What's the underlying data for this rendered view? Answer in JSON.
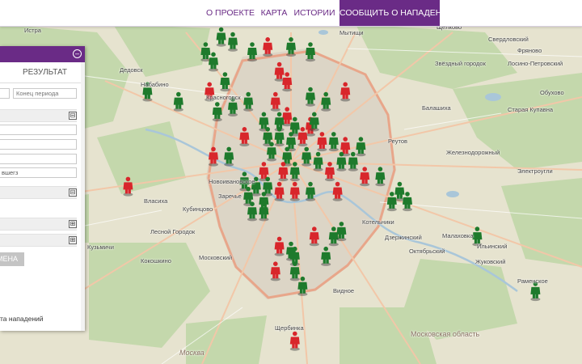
{
  "nav": {
    "items": [
      {
        "label": "О ПРОЕКТЕ"
      },
      {
        "label": "КАРТА"
      },
      {
        "label": "ИСТОРИИ"
      },
      {
        "label": "СООБЩИТЬ О НАПАДЕНИИ"
      }
    ],
    "active_index": 3,
    "accent_color": "#6a2b86"
  },
  "panel": {
    "close_icon": "close-circle-icon",
    "tab_result": "РЕЗУЛЬТАТ",
    "period_end_placeholder": "Конец периода",
    "victim_field_value": "вшегз",
    "apply_button": "МЕНА",
    "footer_text": "та нападений",
    "section_toggles": [
      "⊟",
      "⊟",
      "⊞",
      "⊞"
    ]
  },
  "map": {
    "labels": [
      {
        "text": "Истра"
      },
      {
        "text": "Мытищи"
      },
      {
        "text": "Щёлково"
      },
      {
        "text": "Свердловский"
      },
      {
        "text": "Звёздный городок"
      },
      {
        "text": "Лосино-Петровский"
      },
      {
        "text": "Фряново"
      },
      {
        "text": "Дедовск"
      },
      {
        "text": "Набабино"
      },
      {
        "text": "Балашиха"
      },
      {
        "text": "Старая Купавна"
      },
      {
        "text": "Красногорск"
      },
      {
        "text": "Реутов"
      },
      {
        "text": "Железнодорожный"
      },
      {
        "text": "Электроугли"
      },
      {
        "text": "Новоивановское"
      },
      {
        "text": "Заречье"
      },
      {
        "text": "Власиха"
      },
      {
        "text": "Лесной Городок"
      },
      {
        "text": "Кубинцово"
      },
      {
        "text": "Котельники"
      },
      {
        "text": "Дзержинский"
      },
      {
        "text": "Малаховка"
      },
      {
        "text": "Октябрьский"
      },
      {
        "text": "Жуковский"
      },
      {
        "text": "Раменское"
      },
      {
        "text": "Кокошкино"
      },
      {
        "text": "Московский"
      },
      {
        "text": "Видное"
      },
      {
        "text": "Щербинка"
      },
      {
        "text": "Москва"
      },
      {
        "text": "Московская область"
      },
      {
        "text": "Обухово"
      },
      {
        "text": "Ильинский"
      },
      {
        "text": "Кузьмичи"
      }
    ],
    "marker_colors": {
      "green": "#1e7a2c",
      "red": "#d8262b"
    },
    "markers": [
      {
        "color": "green",
        "lat": 55.95,
        "lon": 37.47
      },
      {
        "color": "green",
        "lat": 55.94,
        "lon": 37.5
      },
      {
        "color": "green",
        "lat": 55.92,
        "lon": 37.43
      },
      {
        "color": "green",
        "lat": 55.92,
        "lon": 37.55
      },
      {
        "color": "red",
        "lat": 55.93,
        "lon": 37.59
      },
      {
        "color": "green",
        "lat": 55.93,
        "lon": 37.65
      },
      {
        "color": "green",
        "lat": 55.92,
        "lon": 37.7
      },
      {
        "color": "green",
        "lat": 55.9,
        "lon": 37.45
      },
      {
        "color": "red",
        "lat": 55.88,
        "lon": 37.62
      },
      {
        "color": "red",
        "lat": 55.86,
        "lon": 37.64
      },
      {
        "color": "green",
        "lat": 55.86,
        "lon": 37.48
      },
      {
        "color": "green",
        "lat": 55.84,
        "lon": 37.28
      },
      {
        "color": "red",
        "lat": 55.84,
        "lon": 37.44
      },
      {
        "color": "green",
        "lat": 55.82,
        "lon": 37.36
      },
      {
        "color": "green",
        "lat": 55.81,
        "lon": 37.5
      },
      {
        "color": "green",
        "lat": 55.82,
        "lon": 37.54
      },
      {
        "color": "red",
        "lat": 55.82,
        "lon": 37.61
      },
      {
        "color": "green",
        "lat": 55.83,
        "lon": 37.7
      },
      {
        "color": "green",
        "lat": 55.82,
        "lon": 37.74
      },
      {
        "color": "red",
        "lat": 55.84,
        "lon": 37.79
      },
      {
        "color": "green",
        "lat": 55.8,
        "lon": 37.46
      },
      {
        "color": "red",
        "lat": 55.79,
        "lon": 37.64
      },
      {
        "color": "green",
        "lat": 55.78,
        "lon": 37.58
      },
      {
        "color": "green",
        "lat": 55.78,
        "lon": 37.62
      },
      {
        "color": "green",
        "lat": 55.77,
        "lon": 37.66
      },
      {
        "color": "red",
        "lat": 55.77,
        "lon": 37.7
      },
      {
        "color": "green",
        "lat": 55.78,
        "lon": 37.71
      },
      {
        "color": "red",
        "lat": 55.75,
        "lon": 37.53
      },
      {
        "color": "green",
        "lat": 55.75,
        "lon": 37.59
      },
      {
        "color": "green",
        "lat": 55.75,
        "lon": 37.62
      },
      {
        "color": "green",
        "lat": 55.74,
        "lon": 37.65
      },
      {
        "color": "red",
        "lat": 55.75,
        "lon": 37.68
      },
      {
        "color": "red",
        "lat": 55.74,
        "lon": 37.73
      },
      {
        "color": "green",
        "lat": 55.74,
        "lon": 37.76
      },
      {
        "color": "red",
        "lat": 55.73,
        "lon": 37.79
      },
      {
        "color": "green",
        "lat": 55.73,
        "lon": 37.83
      },
      {
        "color": "red",
        "lat": 55.71,
        "lon": 37.45
      },
      {
        "color": "green",
        "lat": 55.71,
        "lon": 37.49
      },
      {
        "color": "green",
        "lat": 55.72,
        "lon": 37.6
      },
      {
        "color": "green",
        "lat": 55.71,
        "lon": 37.64
      },
      {
        "color": "green",
        "lat": 55.71,
        "lon": 37.69
      },
      {
        "color": "green",
        "lat": 55.7,
        "lon": 37.72
      },
      {
        "color": "green",
        "lat": 55.7,
        "lon": 37.78
      },
      {
        "color": "green",
        "lat": 55.7,
        "lon": 37.81
      },
      {
        "color": "red",
        "lat": 55.68,
        "lon": 37.58
      },
      {
        "color": "red",
        "lat": 55.68,
        "lon": 37.63
      },
      {
        "color": "green",
        "lat": 55.68,
        "lon": 37.66
      },
      {
        "color": "red",
        "lat": 55.68,
        "lon": 37.75
      },
      {
        "color": "red",
        "lat": 55.67,
        "lon": 37.84
      },
      {
        "color": "green",
        "lat": 55.67,
        "lon": 37.88
      },
      {
        "color": "red",
        "lat": 55.65,
        "lon": 37.23
      },
      {
        "color": "green",
        "lat": 55.66,
        "lon": 37.53
      },
      {
        "color": "green",
        "lat": 55.65,
        "lon": 37.56
      },
      {
        "color": "green",
        "lat": 55.65,
        "lon": 37.59
      },
      {
        "color": "red",
        "lat": 55.64,
        "lon": 37.62
      },
      {
        "color": "red",
        "lat": 55.64,
        "lon": 37.66
      },
      {
        "color": "green",
        "lat": 55.64,
        "lon": 37.7
      },
      {
        "color": "red",
        "lat": 55.64,
        "lon": 37.77
      },
      {
        "color": "green",
        "lat": 55.64,
        "lon": 37.93
      },
      {
        "color": "green",
        "lat": 55.63,
        "lon": 37.54
      },
      {
        "color": "green",
        "lat": 55.62,
        "lon": 37.58
      },
      {
        "color": "green",
        "lat": 55.62,
        "lon": 37.91
      },
      {
        "color": "green",
        "lat": 55.62,
        "lon": 37.95
      },
      {
        "color": "green",
        "lat": 55.6,
        "lon": 37.55
      },
      {
        "color": "green",
        "lat": 55.6,
        "lon": 37.58
      },
      {
        "color": "red",
        "lat": 55.55,
        "lon": 37.71
      },
      {
        "color": "green",
        "lat": 55.55,
        "lon": 37.76
      },
      {
        "color": "green",
        "lat": 55.56,
        "lon": 37.78
      },
      {
        "color": "green",
        "lat": 55.55,
        "lon": 38.13
      },
      {
        "color": "red",
        "lat": 55.53,
        "lon": 37.62
      },
      {
        "color": "green",
        "lat": 55.52,
        "lon": 37.65
      },
      {
        "color": "green",
        "lat": 55.51,
        "lon": 37.74
      },
      {
        "color": "green",
        "lat": 55.51,
        "lon": 37.66
      },
      {
        "color": "red",
        "lat": 55.48,
        "lon": 37.61
      },
      {
        "color": "green",
        "lat": 55.48,
        "lon": 37.66
      },
      {
        "color": "green",
        "lat": 55.45,
        "lon": 37.68
      },
      {
        "color": "green",
        "lat": 55.44,
        "lon": 38.28
      },
      {
        "color": "red",
        "lat": 55.34,
        "lon": 37.66
      }
    ]
  }
}
